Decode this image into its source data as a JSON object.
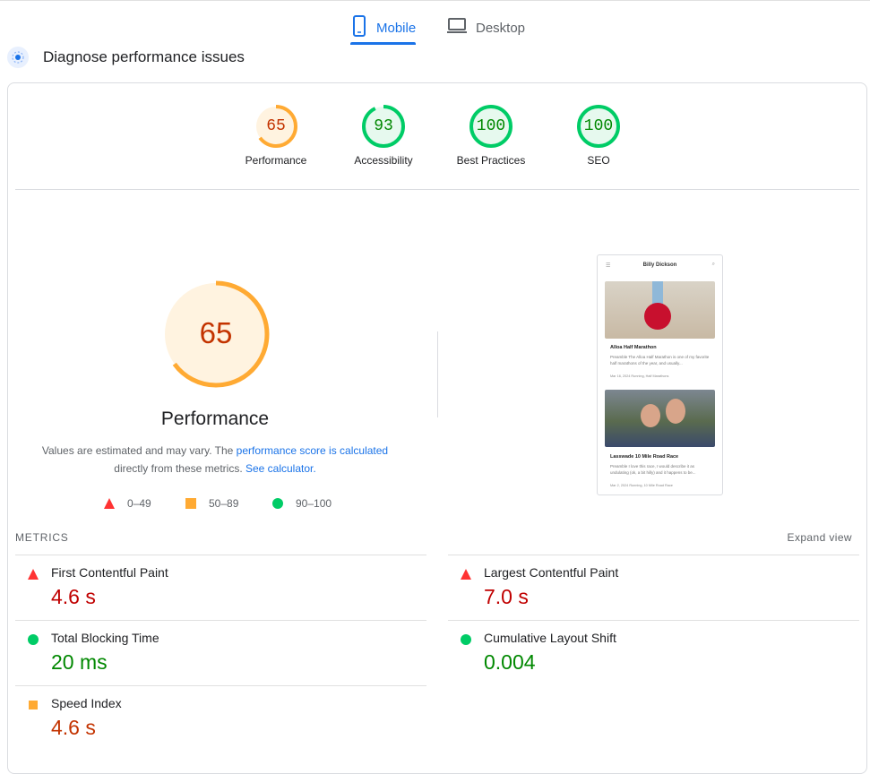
{
  "tabs": {
    "mobile": "Mobile",
    "desktop": "Desktop"
  },
  "header": {
    "title": "Diagnose performance issues"
  },
  "scores": [
    {
      "label": "Performance",
      "value": "65",
      "color": "#fa3"
    },
    {
      "label": "Accessibility",
      "value": "93",
      "color": "#0c6"
    },
    {
      "label": "Best Practices",
      "value": "100",
      "color": "#0c6"
    },
    {
      "label": "SEO",
      "value": "100",
      "color": "#0c6"
    }
  ],
  "main": {
    "score": "65",
    "title": "Performance",
    "note_prefix": "Values are estimated and may vary. The ",
    "note_link1": "performance score is calculated",
    "note_mid": " directly from these metrics. ",
    "note_link2": "See calculator."
  },
  "legend": {
    "fail": "0–49",
    "average": "50–89",
    "pass": "90–100"
  },
  "preview": {
    "site_title": "Billy Dickson",
    "post1_title": "Alloa Half Marathon",
    "post1_excerpt": "Preamble The Alloa Half Marathon is one of my favorite half marathons of the year, and usually...",
    "post1_meta": "Mar 16, 2024   Running, Half Marathons",
    "post2_title": "Lasswade 10 Mile Road Race",
    "post2_excerpt": "Preamble I love this race, I would describe it as undulating (ok, a bit hilly) and it happens to be...",
    "post2_meta": "Mar 2, 2024   Running, 10 Mile Road Race"
  },
  "metrics": {
    "label": "METRICS",
    "expand": "Expand view",
    "fcp": {
      "name": "First Contentful Paint",
      "value": "4.6 s"
    },
    "lcp": {
      "name": "Largest Contentful Paint",
      "value": "7.0 s"
    },
    "tbt": {
      "name": "Total Blocking Time",
      "value": "20 ms"
    },
    "cls": {
      "name": "Cumulative Layout Shift",
      "value": "0.004"
    },
    "si": {
      "name": "Speed Index",
      "value": "4.6 s"
    }
  },
  "colors": {
    "accent": "#1a73e8",
    "fail": "#f33",
    "average": "#fa3",
    "pass": "#0c6"
  },
  "icons": [
    "mobile-icon",
    "desktop-icon",
    "lighthouse-icon"
  ]
}
